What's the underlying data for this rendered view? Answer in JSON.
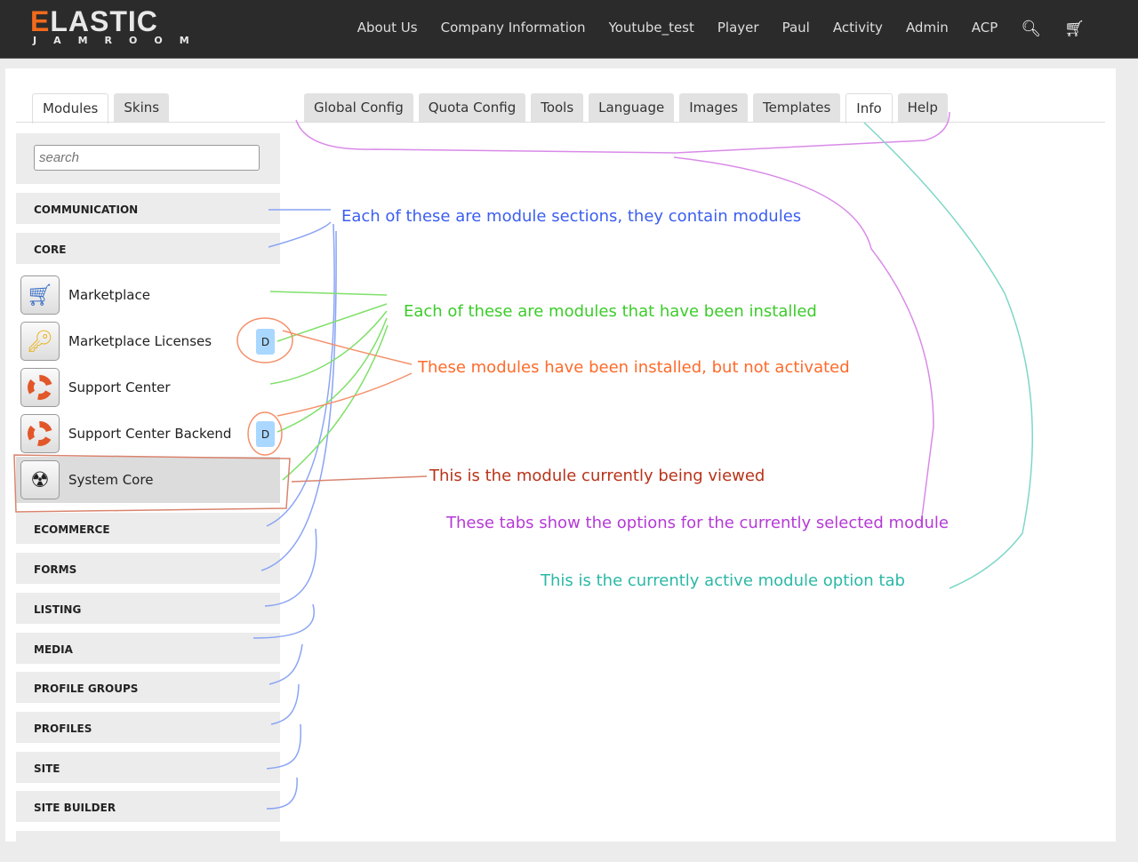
{
  "logo": {
    "word": "ELASTIC",
    "sub": "JAMROOM"
  },
  "nav": [
    "About Us",
    "Company Information",
    "Youtube_test",
    "Player",
    "Paul",
    "Activity",
    "Admin",
    "ACP"
  ],
  "left_tabs": [
    "Modules",
    "Skins"
  ],
  "option_tabs": [
    "Global Config",
    "Quota Config",
    "Tools",
    "Language",
    "Images",
    "Templates",
    "Info",
    "Help"
  ],
  "active_option_tab": "Info",
  "search": {
    "placeholder": "search"
  },
  "sections_top": [
    "COMMUNICATION",
    "CORE"
  ],
  "modules": [
    {
      "name": "Marketplace",
      "icon": "cart-icon",
      "badge": null
    },
    {
      "name": "Marketplace Licenses",
      "icon": "key-icon",
      "badge": "D"
    },
    {
      "name": "Support Center",
      "icon": "lifebuoy-icon",
      "badge": null
    },
    {
      "name": "Support Center Backend",
      "icon": "lifebuoy-icon",
      "badge": "D"
    },
    {
      "name": "System Core",
      "icon": "radiation-icon",
      "badge": null,
      "selected": true
    }
  ],
  "sections_bottom": [
    "ECOMMERCE",
    "FORMS",
    "LISTING",
    "MEDIA",
    "PROFILE GROUPS",
    "PROFILES",
    "SITE",
    "SITE BUILDER"
  ],
  "annotations": {
    "sections": "Each of these are module sections, they contain modules",
    "installed": "Each of these are modules that have been installed",
    "not_active": "These modules have been installed, but not activated",
    "current": "This is the module currently being viewed",
    "tabs": "These tabs show the options for the currently selected module",
    "active_tab": "This is the currently active module option tab"
  },
  "colors": {
    "blue": "#3b5ef0",
    "green": "#3ccc2a",
    "orange": "#ff6a2a",
    "red": "#b8331a",
    "purple": "#b53ad6",
    "teal": "#2bb8a5",
    "accent": "#f26a1b"
  }
}
